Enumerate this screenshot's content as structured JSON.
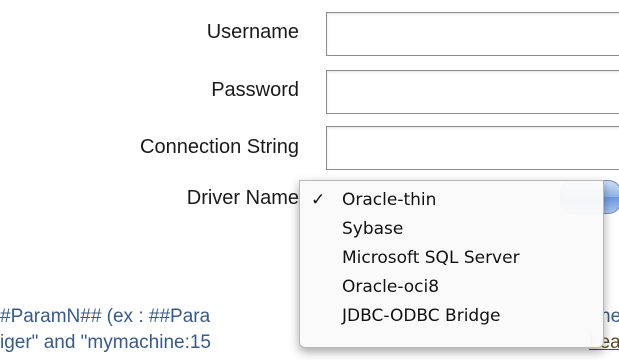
{
  "form": {
    "username_label": "Username",
    "username_value": "",
    "password_label": "Password",
    "password_value": "",
    "connection_label": "Connection String",
    "connection_value": "",
    "driver_label": "Driver Name"
  },
  "driver_menu": {
    "selected": "Oracle-thin",
    "check_mark": "✓",
    "items": [
      {
        "label": "Oracle-thin",
        "checked": true
      },
      {
        "label": "Sybase",
        "checked": false
      },
      {
        "label": "Microsoft SQL Server",
        "checked": false
      },
      {
        "label": "Oracle-oci8",
        "checked": false
      },
      {
        "label": "JDBC-ODBC Bridge",
        "checked": false
      }
    ]
  },
  "hint": {
    "line1_left": "#ParamN## (ex : ##Para",
    "line1_right": "ne",
    "line2_left": "iger\" and \"mymachine:15",
    "line2_link": "Lea"
  },
  "colors": {
    "hint_text": "#3a5a86",
    "popup_button": "#6d97df"
  }
}
